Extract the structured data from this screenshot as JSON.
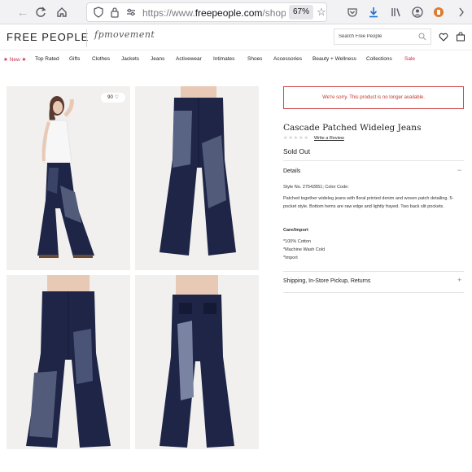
{
  "browser": {
    "url_prefix": "https://www.",
    "url_host": "freepeople.com",
    "url_path": "/shop/ca",
    "zoom": "67%"
  },
  "header": {
    "brand": "FREE PEOPLE",
    "sub_brand": "fpmovement",
    "search_placeholder": "Search Free People"
  },
  "nav": {
    "items": [
      {
        "label": "★ New ★",
        "accent": true
      },
      {
        "label": "Top Rated"
      },
      {
        "label": "Gifts"
      },
      {
        "label": "Clothes"
      },
      {
        "label": "Jackets"
      },
      {
        "label": "Jeans"
      },
      {
        "label": "Activewear"
      },
      {
        "label": "Intimates"
      },
      {
        "label": "Shoes"
      },
      {
        "label": "Accessories"
      },
      {
        "label": "Beauty + Wellness"
      },
      {
        "label": "Collections"
      },
      {
        "label": "Sale",
        "accent": true
      }
    ]
  },
  "gallery": {
    "like_count": "90"
  },
  "product": {
    "alert": "We're sorry. This product is no longer available.",
    "title": "Cascade Patched Wideleg Jeans",
    "rating_stars": "★★★★★",
    "review_link": "Write a Review",
    "status": "Sold Out",
    "details_heading": "Details",
    "style_line": "Style No. 27542851; Color Code:",
    "description": "Patched together wideleg jeans with floral printed denim and woven patch detailing. 5-pocket style. Bottom hems are raw edge and lightly frayed. Two back slit pockets.",
    "care_heading": "Care/Import",
    "care_items": [
      "*100% Cotton",
      "*Machine Wash Cold",
      "*Import"
    ],
    "shipping_heading": "Shipping, In-Store Pickup, Returns"
  },
  "colors": {
    "accent": "#c8324a",
    "denim": "#1e2547"
  }
}
